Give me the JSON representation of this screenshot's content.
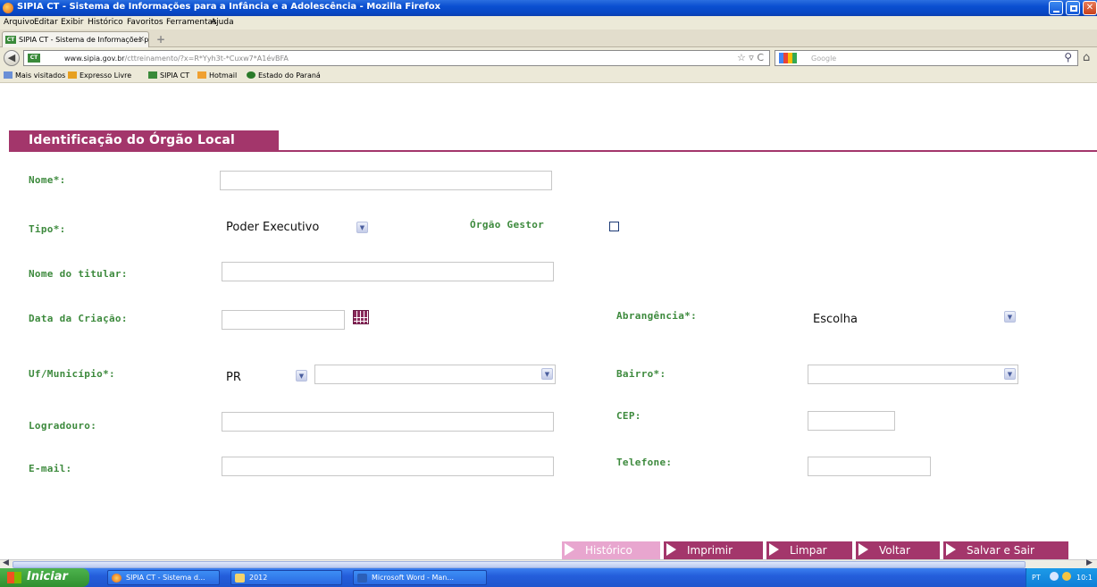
{
  "window": {
    "title": "SIPIA CT - Sistema de Informações para a Infância e a Adolescência - Mozilla Firefox"
  },
  "menu": [
    "Arquivo",
    "Editar",
    "Exibir",
    "Histórico",
    "Favoritos",
    "Ferramentas",
    "Ajuda"
  ],
  "tab": {
    "label": "SIPIA CT - Sistema de Informações para a I...",
    "favicon": "CT"
  },
  "address": {
    "domain": "www.sipia.gov.br",
    "path": "/cttreinamento/?x=R*Yyh3t-*Cuxw7*A1évBFA",
    "search_placeholder": "Google"
  },
  "bookmarks": [
    "Mais visitados",
    "Expresso Livre",
    "SIPIA CT",
    "Hotmail",
    "Estado do Paraná"
  ],
  "page": {
    "banner": "Identificação do Órgão Local",
    "labels": {
      "nome": "Nome*:",
      "tipo": "Tipo*:",
      "orgao_gestor": "Órgão Gestor",
      "nome_titular": "Nome do titular:",
      "data_criacao": "Data da Criação:",
      "abrangencia": "Abrangência*:",
      "uf_municipio": "Uf/Município*:",
      "bairro": "Bairro*:",
      "logradouro": "Logradouro:",
      "cep": "CEP:",
      "email": "E-mail:",
      "telefone": "Telefone:"
    },
    "values": {
      "nome": "",
      "tipo": "Poder Executivo",
      "orgao_gestor_checked": false,
      "nome_titular": "",
      "data_criacao": "",
      "abrangencia": "Escolha",
      "uf": "PR",
      "municipio": "",
      "bairro": "",
      "logradouro": "",
      "cep": "",
      "email": "",
      "telefone": ""
    },
    "buttons": {
      "historico": "Histórico",
      "imprimir": "Imprimir",
      "limpar": "Limpar",
      "voltar": "Voltar",
      "salvar": "Salvar e Sair"
    },
    "colors": {
      "accent": "#a3366b",
      "label": "#3d8a3d",
      "disabled_button": "#e8a6cf"
    }
  },
  "taskbar": {
    "start": "Iniciar",
    "tasks": [
      "SIPIA CT - Sistema d...",
      "2012",
      "Microsoft Word - Man..."
    ],
    "lang": "PT",
    "clock": "10:1"
  }
}
